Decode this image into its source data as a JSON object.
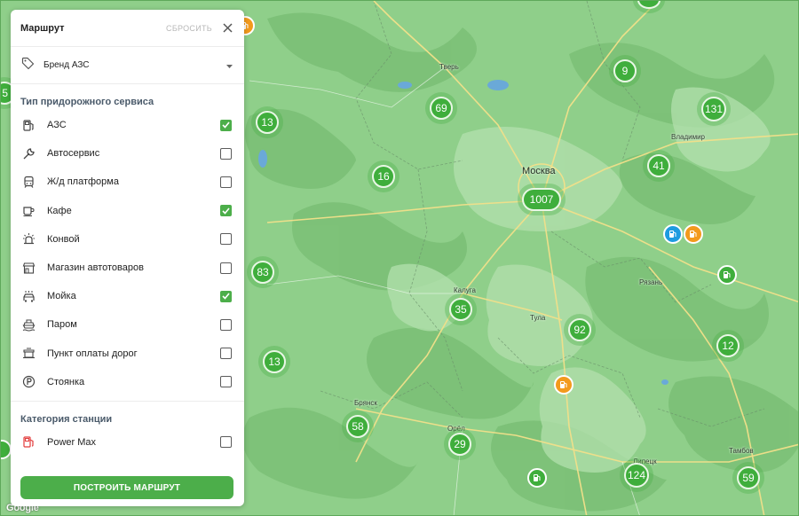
{
  "panel": {
    "title": "Маршрут",
    "reset_label": "СБРОСИТЬ",
    "brand_select_label": "Бренд АЗС",
    "section_service": "Тип придорожного сервиса",
    "services": [
      {
        "label": "АЗС",
        "checked": true,
        "icon": "gas-station-icon"
      },
      {
        "label": "Автосервис",
        "checked": false,
        "icon": "wrench-icon"
      },
      {
        "label": "Ж/д платформа",
        "checked": false,
        "icon": "train-icon"
      },
      {
        "label": "Кафе",
        "checked": true,
        "icon": "coffee-cup-icon"
      },
      {
        "label": "Конвой",
        "checked": false,
        "icon": "beacon-light-icon"
      },
      {
        "label": "Магазин автотоваров",
        "checked": false,
        "icon": "store-icon"
      },
      {
        "label": "Мойка",
        "checked": true,
        "icon": "car-wash-icon"
      },
      {
        "label": "Паром",
        "checked": false,
        "icon": "ferry-icon"
      },
      {
        "label": "Пункт оплаты дорог",
        "checked": false,
        "icon": "toll-gate-icon"
      },
      {
        "label": "Стоянка",
        "checked": false,
        "icon": "parking-icon"
      }
    ],
    "section_category": "Категория станции",
    "categories": [
      {
        "label": "Power Max",
        "checked": false,
        "icon": "power-max-fuel-icon"
      }
    ],
    "build_button": "ПОСТРОИТЬ МАРШРУТ"
  },
  "map": {
    "attribution": "Google",
    "cities": [
      "Москва",
      "Тверь",
      "Владимир",
      "Калуга",
      "Тула",
      "Рязань",
      "Брянск",
      "Орёл",
      "Липецк",
      "Тамбов"
    ],
    "clusters": [
      "13",
      "69",
      "9",
      "131",
      "16",
      "1007",
      "41",
      "83",
      "35",
      "92",
      "12",
      "13",
      "58",
      "29",
      "124",
      "59",
      "5"
    ],
    "colors": {
      "cluster": "#3fae3c",
      "pin_blue": "#1e9be0",
      "pin_orange": "#f39a1c",
      "pin_green": "#3fae3c",
      "accent": "#4cae4a"
    }
  }
}
